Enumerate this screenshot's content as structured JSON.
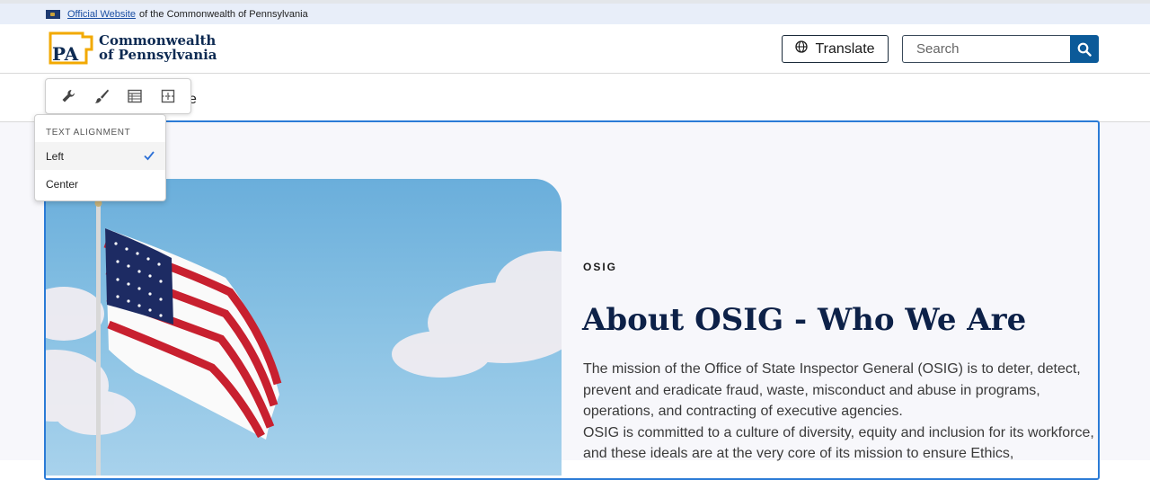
{
  "official_bar": {
    "link_text": "Official Website",
    "suffix": "of the Commonwealth of Pennsylvania"
  },
  "header": {
    "logo_mark": "PA",
    "logo_line1": "Commonwealth",
    "logo_line2": "of Pennsylvania",
    "translate_label": "Translate",
    "search_placeholder": "Search"
  },
  "nav": {
    "peek_text": "e"
  },
  "toolbar": {
    "tools": [
      "wrench-icon",
      "paintbrush-icon",
      "table-icon",
      "layout-icon"
    ]
  },
  "dropdown": {
    "heading": "TEXT ALIGNMENT",
    "options": [
      {
        "label": "Left",
        "selected": true
      },
      {
        "label": "Center",
        "selected": false
      }
    ]
  },
  "hero": {
    "eyebrow": "OSIG",
    "title": "About OSIG - Who We Are",
    "paragraph1": "The mission of the Office of State Inspector General (OSIG) is to deter, detect, prevent and eradicate fraud, waste, misconduct and abuse in programs, operations, and contracting of executive agencies.",
    "paragraph2": "OSIG is committed to a culture of diversity, equity and inclusion for its workforce, and these ideals are at the very core of its mission to ensure Ethics,"
  },
  "colors": {
    "brand_navy": "#0d2148",
    "search_button": "#0b5a99",
    "editor_outline": "#2b7bd6",
    "logo_gold": "#f2a900"
  }
}
